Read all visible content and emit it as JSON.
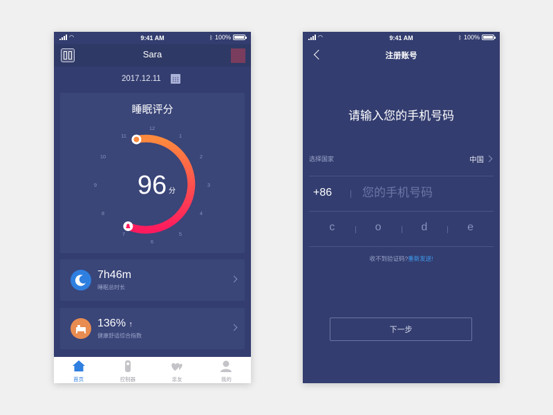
{
  "status_bar": {
    "time": "9:41 AM",
    "battery": "100%"
  },
  "home": {
    "header": {
      "title": "Sara"
    },
    "date": "2017.12.11",
    "score_card": {
      "title": "睡眠评分",
      "score": "96",
      "unit": "分",
      "clock_numbers": [
        "12",
        "1",
        "2",
        "3",
        "4",
        "5",
        "6",
        "7",
        "8",
        "9",
        "10",
        "11"
      ]
    },
    "stats": [
      {
        "value": "7h46m",
        "label": "睡眠总时长",
        "icon": "moon-icon"
      },
      {
        "value": "136%",
        "label": "健康舒适综合指数",
        "icon": "bed-icon",
        "trend": "up"
      }
    ],
    "tabs": [
      {
        "label": "首页",
        "icon": "home-icon",
        "active": true
      },
      {
        "label": "控制器",
        "icon": "remote-icon",
        "active": false
      },
      {
        "label": "亲友",
        "icon": "friends-icon",
        "active": false
      },
      {
        "label": "我的",
        "icon": "user-icon",
        "active": false
      }
    ]
  },
  "register": {
    "header": {
      "title": "注册账号"
    },
    "prompt": "请输入您的手机号码",
    "country": {
      "label": "选择国家",
      "value": "中国"
    },
    "phone": {
      "code": "+86",
      "placeholder": "您的手机号码"
    },
    "code_chars": [
      "c",
      "o",
      "d",
      "e"
    ],
    "resend": {
      "text": "收不到验证码?",
      "link": "重新发送!"
    },
    "next_label": "下一步"
  },
  "colors": {
    "bg": "#333d6f",
    "card": "#3a4578",
    "accent_blue": "#2e7fe0",
    "arc_start": "#ff8a3d",
    "arc_end": "#ff1a5e"
  }
}
